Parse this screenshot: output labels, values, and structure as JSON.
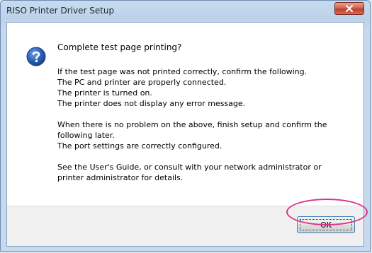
{
  "window": {
    "title": "RISO Printer Driver Setup",
    "close_icon": "close-icon"
  },
  "dialog": {
    "icon": "question-icon",
    "heading": "Complete test page printing?",
    "lines": {
      "l1": "If the test page was not printed correctly, confirm the following.",
      "l2": " The PC and printer are properly connected.",
      "l3": " The printer is turned on.",
      "l4": " The printer does not display any error message.",
      "l5": "When there is no problem on the above, finish setup and confirm the",
      "l6": "following later.",
      "l7": " The port settings are correctly configured.",
      "l8": "See the User's Guide, or consult with your network administrator or",
      "l9": "printer administrator for details."
    }
  },
  "buttons": {
    "ok_label": "OK"
  },
  "colors": {
    "annotation": "#d9338a",
    "icon_blue": "#2a62b8"
  }
}
